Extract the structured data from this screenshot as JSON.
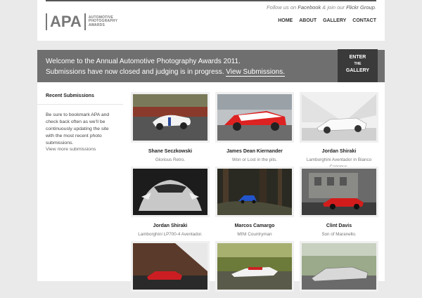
{
  "header": {
    "logo_mark": "APA",
    "logo_lines": [
      "AUTOMOTIVE",
      "PHOTOGRAPHY",
      "AWARDS"
    ],
    "follow": {
      "prefix": "Follow us on ",
      "facebook": "Facebook",
      "middle": " & join our ",
      "flickr": "Flickr Group",
      "suffix": "."
    },
    "nav": [
      "HOME",
      "ABOUT",
      "GALLERY",
      "CONTACT"
    ]
  },
  "banner": {
    "line1": "Welcome to the Annual Automotive Photography Awards 2011.",
    "line2_prefix": "Submissions have now closed and judging is in progress. ",
    "line2_link": "View Submissions.",
    "enter": {
      "top": "ENTER",
      "middle": "THE",
      "bottom": "GALLERY"
    }
  },
  "sidebar": {
    "title": "Recent Submissions",
    "body": "Be sure to bookmark APA and check back often as we'll be continuously updating the site with the most recent photo submissions.",
    "more_link": "View more submissions"
  },
  "gallery": [
    {
      "name": "Shane Seczkowski",
      "caption": "Glorious Retro.",
      "icon": "white-racecar-photo"
    },
    {
      "name": "James Dean Kiernander",
      "caption": "Won or Lost in the pits.",
      "icon": "vodafone-racecar-photo"
    },
    {
      "name": "Jordan Shiraki",
      "caption": "Lamborghini Aventador in Bianco Canopus.",
      "icon": "white-lamborghini-photo"
    },
    {
      "name": "Jordan Shiraki",
      "caption": "Lamborghini LP700-4 Aventador.",
      "icon": "lamborghini-front-photo"
    },
    {
      "name": "Marcos Camargo",
      "caption": "MINI Countryman",
      "icon": "blue-mini-forest-photo"
    },
    {
      "name": "Clint Davis",
      "caption": "Son of Maranello.",
      "icon": "red-ferrari-photo"
    },
    {
      "name": "",
      "caption": "",
      "icon": "red-car-tunnel-photo"
    },
    {
      "name": "",
      "caption": "",
      "icon": "formula-car-photo"
    },
    {
      "name": "",
      "caption": "",
      "icon": "silver-mercedes-photo"
    }
  ],
  "colors": {
    "banner": "#6f6f6f",
    "enter_tab": "#3a3a3a",
    "background": "#eaeaea"
  }
}
